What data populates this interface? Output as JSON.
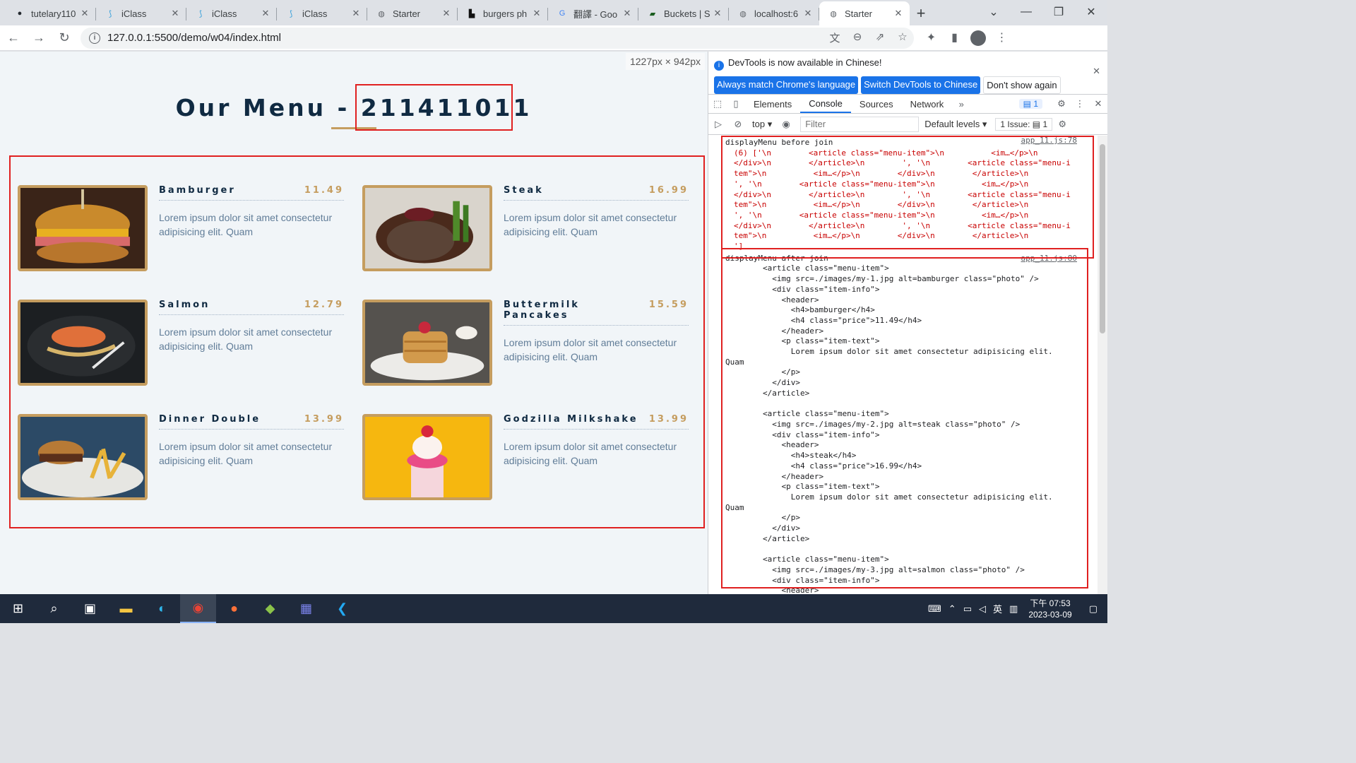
{
  "browser": {
    "tabs": [
      {
        "title": "tutelary110",
        "icon": "github-icon",
        "color": "#24292f"
      },
      {
        "title": "iClass",
        "icon": "iclass-icon",
        "color": "#2d9cdb"
      },
      {
        "title": "iClass",
        "icon": "iclass-icon",
        "color": "#2d9cdb"
      },
      {
        "title": "iClass",
        "icon": "iclass-icon",
        "color": "#2d9cdb"
      },
      {
        "title": "Starter",
        "icon": "globe-icon",
        "color": "#5f6368"
      },
      {
        "title": "burgers ph",
        "icon": "unsplash-icon",
        "color": "#111111"
      },
      {
        "title": "翻譯 - Goo",
        "icon": "google-icon",
        "color": "#4285f4"
      },
      {
        "title": "Buckets | S",
        "icon": "buckets-icon",
        "color": "#1b5e20"
      },
      {
        "title": "localhost:6",
        "icon": "globe-icon",
        "color": "#5f6368"
      },
      {
        "title": "Starter",
        "icon": "globe-icon",
        "color": "#5f6368",
        "active": true
      }
    ],
    "url": "127.0.0.1:5500/demo/w04/index.html"
  },
  "page": {
    "dims": "1227px × 942px",
    "title": "Our Menu - 211411011",
    "items": [
      {
        "name": "Bamburger",
        "price": "11.49",
        "text": "Lorem ipsum dolor sit amet consectetur adipisicing elit. Quam",
        "photo": "burger-photo"
      },
      {
        "name": "Steak",
        "price": "16.99",
        "text": "Lorem ipsum dolor sit amet consectetur adipisicing elit. Quam",
        "photo": "steak-photo"
      },
      {
        "name": "Salmon",
        "price": "12.79",
        "text": "Lorem ipsum dolor sit amet consectetur adipisicing elit. Quam",
        "photo": "salmon-photo"
      },
      {
        "name": "Buttermilk Pancakes",
        "price": "15.59",
        "text": "Lorem ipsum dolor sit amet consectetur adipisicing elit. Quam",
        "photo": "pancakes-photo"
      },
      {
        "name": "Dinner Double",
        "price": "13.99",
        "text": "Lorem ipsum dolor sit amet consectetur adipisicing elit. Quam",
        "photo": "dinner-photo"
      },
      {
        "name": "Godzilla Milkshake",
        "price": "13.99",
        "text": "Lorem ipsum dolor sit amet consectetur adipisicing elit. Quam",
        "photo": "milkshake-photo"
      }
    ]
  },
  "devtools": {
    "notice": "DevTools is now available in Chinese!",
    "btn_match": "Always match Chrome's language",
    "btn_switch": "Switch DevTools to Chinese",
    "btn_dont": "Don't show again",
    "tabs": [
      "Elements",
      "Console",
      "Sources",
      "Network"
    ],
    "active_tab": "Console",
    "msg_count": "1",
    "context": "top",
    "filter_placeholder": "Filter",
    "levels": "Default levels",
    "issues": "1 Issue:",
    "issues_count": "1",
    "log1_label": "displayMenu before join",
    "log1_src": "app_11.js:78",
    "log1_body": "(6) ['\\n        <article class=\"menu-item\">\\n          <im…</p>\\n\n</div>\\n        </article>\\n        ', '\\n        <article class=\"menu-i\ntem\">\\n          <im…</p>\\n        </div>\\n        </article>\\n\n', '\\n        <article class=\"menu-item\">\\n          <im…</p>\\n\n</div>\\n        </article>\\n        ', '\\n        <article class=\"menu-i\ntem\">\\n          <im…</p>\\n        </div>\\n        </article>\\n\n', '\\n        <article class=\"menu-item\">\\n          <im…</p>\\n\n</div>\\n        </article>\\n        ', '\\n        <article class=\"menu-i\ntem\">\\n          <im…</p>\\n        </div>\\n        </article>\\n\n']",
    "log2_label": "displayMenu after join",
    "log2_src": "app_11.js:80",
    "log2_body": "        <article class=\"menu-item\">\n          <img src=./images/my-1.jpg alt=bamburger class=\"photo\" />\n          <div class=\"item-info\">\n            <header>\n              <h4>bamburger</h4>\n              <h4 class=\"price\">11.49</h4>\n            </header>\n            <p class=\"item-text\">\n              Lorem ipsum dolor sit amet consectetur adipisicing elit.\nQuam\n            </p>\n          </div>\n        </article>\n\n        <article class=\"menu-item\">\n          <img src=./images/my-2.jpg alt=steak class=\"photo\" />\n          <div class=\"item-info\">\n            <header>\n              <h4>steak</h4>\n              <h4 class=\"price\">16.99</h4>\n            </header>\n            <p class=\"item-text\">\n              Lorem ipsum dolor sit amet consectetur adipisicing elit.\nQuam\n            </p>\n          </div>\n        </article>\n\n        <article class=\"menu-item\">\n          <img src=./images/my-3.jpg alt=salmon class=\"photo\" />\n          <div class=\"item-info\">\n            <header>"
  },
  "taskbar": {
    "ime": "英",
    "time": "下午 07:53",
    "date": "2023-03-09"
  },
  "colors": {
    "accent": "#c59d5f",
    "heading": "#102a42",
    "body_text": "#617d98",
    "annotation": "#e02020",
    "devtools_blue": "#1a73e8"
  }
}
